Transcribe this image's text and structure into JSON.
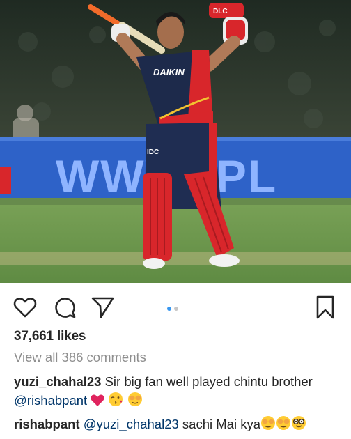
{
  "post": {
    "likes_text": "37,661 likes",
    "view_all_text": "View all 386 comments",
    "carousel": {
      "count": 2,
      "active_index": 0
    }
  },
  "photo_text": {
    "helmet": "DLC",
    "shirt_sponsor": "DAIKIN",
    "trouser_sponsor": "IDC",
    "board": "WWW.IPL"
  },
  "comments": [
    {
      "user": "yuzi_chahal23",
      "text": "Sir big fan well played chintu brother",
      "mention": "@rishabpant",
      "emojis": [
        "red-heart",
        "kiss-face",
        "hands-over-eyes-face"
      ]
    },
    {
      "user": "rishabpant",
      "mention": "@yuzi_chahal23",
      "text": "sachi Mai kya",
      "emojis": [
        "hands-over-eyes-face",
        "hands-over-eyes-face",
        "nerd-face"
      ]
    }
  ],
  "colors": {
    "accent_blue": "#3897f0",
    "mention_blue": "#003569",
    "muted_gray": "#8e8e8e",
    "jersey_red": "#d8262b",
    "jersey_navy": "#1d2a4b",
    "pitch_green": "#6f9a4e"
  }
}
